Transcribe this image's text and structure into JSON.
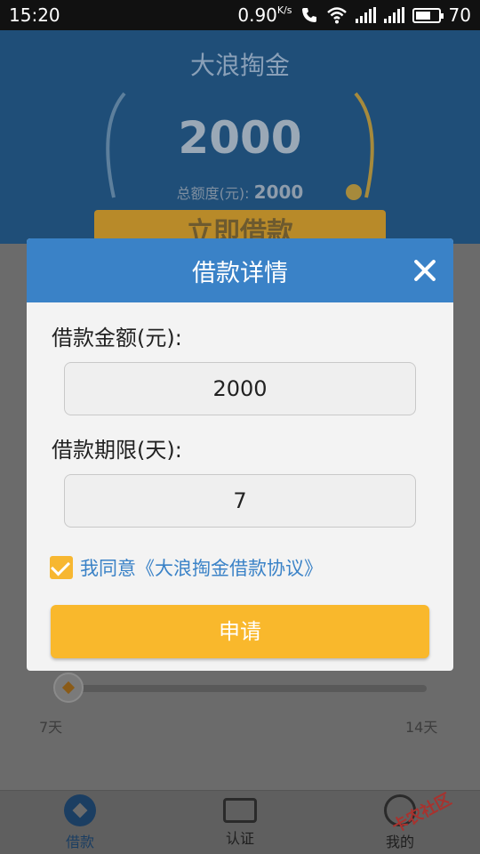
{
  "status_bar": {
    "time": "15:20",
    "speed": "0.90",
    "speed_unit": "K/s",
    "battery": "70"
  },
  "background": {
    "app_title": "大浪掏金",
    "gauge_amount": "2000",
    "total_label": "总额度(元):",
    "total_value": "2000",
    "borrow_now_label": "立即借款",
    "slider_min_label": "7天",
    "slider_max_label": "14天"
  },
  "modal": {
    "title": "借款详情",
    "amount_label": "借款金额(元):",
    "amount_value": "2000",
    "term_label": "借款期限(天):",
    "term_value": "7",
    "agree_text": "我同意《大浪掏金借款协议》",
    "agree_checked": true,
    "apply_label": "申请"
  },
  "bottom_nav": {
    "items": [
      {
        "label": "借款",
        "icon": "borrow-icon",
        "active": true
      },
      {
        "label": "认证",
        "icon": "certification-icon",
        "active": false
      },
      {
        "label": "我的",
        "icon": "profile-icon",
        "active": false
      }
    ]
  },
  "watermark": "卡农社区",
  "colors": {
    "modal_header": "#3a82c7",
    "apply_button": "#f9b82c",
    "link": "#3a82c7"
  }
}
